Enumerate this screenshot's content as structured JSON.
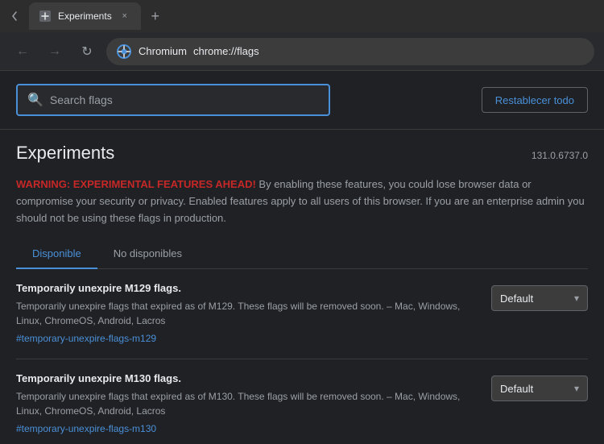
{
  "titlebar": {
    "tab_title": "Experiments",
    "tab_close": "×",
    "new_tab": "+"
  },
  "navbar": {
    "back_icon": "←",
    "forward_icon": "→",
    "reload_icon": "↻",
    "brand_name": "Chromium",
    "url": "chrome://flags"
  },
  "search": {
    "placeholder": "Search flags",
    "reset_label": "Restablecer todo"
  },
  "page": {
    "title": "Experiments",
    "version": "131.0.6737.0"
  },
  "warning": {
    "label": "WARNING: EXPERIMENTAL FEATURES AHEAD!",
    "text": " By enabling these features, you could lose browser data or compromise your security or privacy. Enabled features apply to all users of this browser. If you are an enterprise admin you should not be using these flags in production."
  },
  "tabs": [
    {
      "id": "available",
      "label": "Disponible",
      "active": true
    },
    {
      "id": "unavailable",
      "label": "No disponibles",
      "active": false
    }
  ],
  "flags": [
    {
      "title": "Temporarily unexpire M129 flags.",
      "description": "Temporarily unexpire flags that expired as of M129. These flags will be removed soon. – Mac, Windows, Linux, ChromeOS, Android, Lacros",
      "link": "#temporary-unexpire-flags-m129",
      "dropdown_value": "Default"
    },
    {
      "title": "Temporarily unexpire M130 flags.",
      "description": "Temporarily unexpire flags that expired as of M130. These flags will be removed soon. – Mac, Windows, Linux, ChromeOS, Android, Lacros",
      "link": "#temporary-unexpire-flags-m130",
      "dropdown_value": "Default"
    }
  ],
  "icons": {
    "search": "🔍",
    "back": "←",
    "forward": "→",
    "reload": "↻",
    "chevron_down": "▾"
  }
}
